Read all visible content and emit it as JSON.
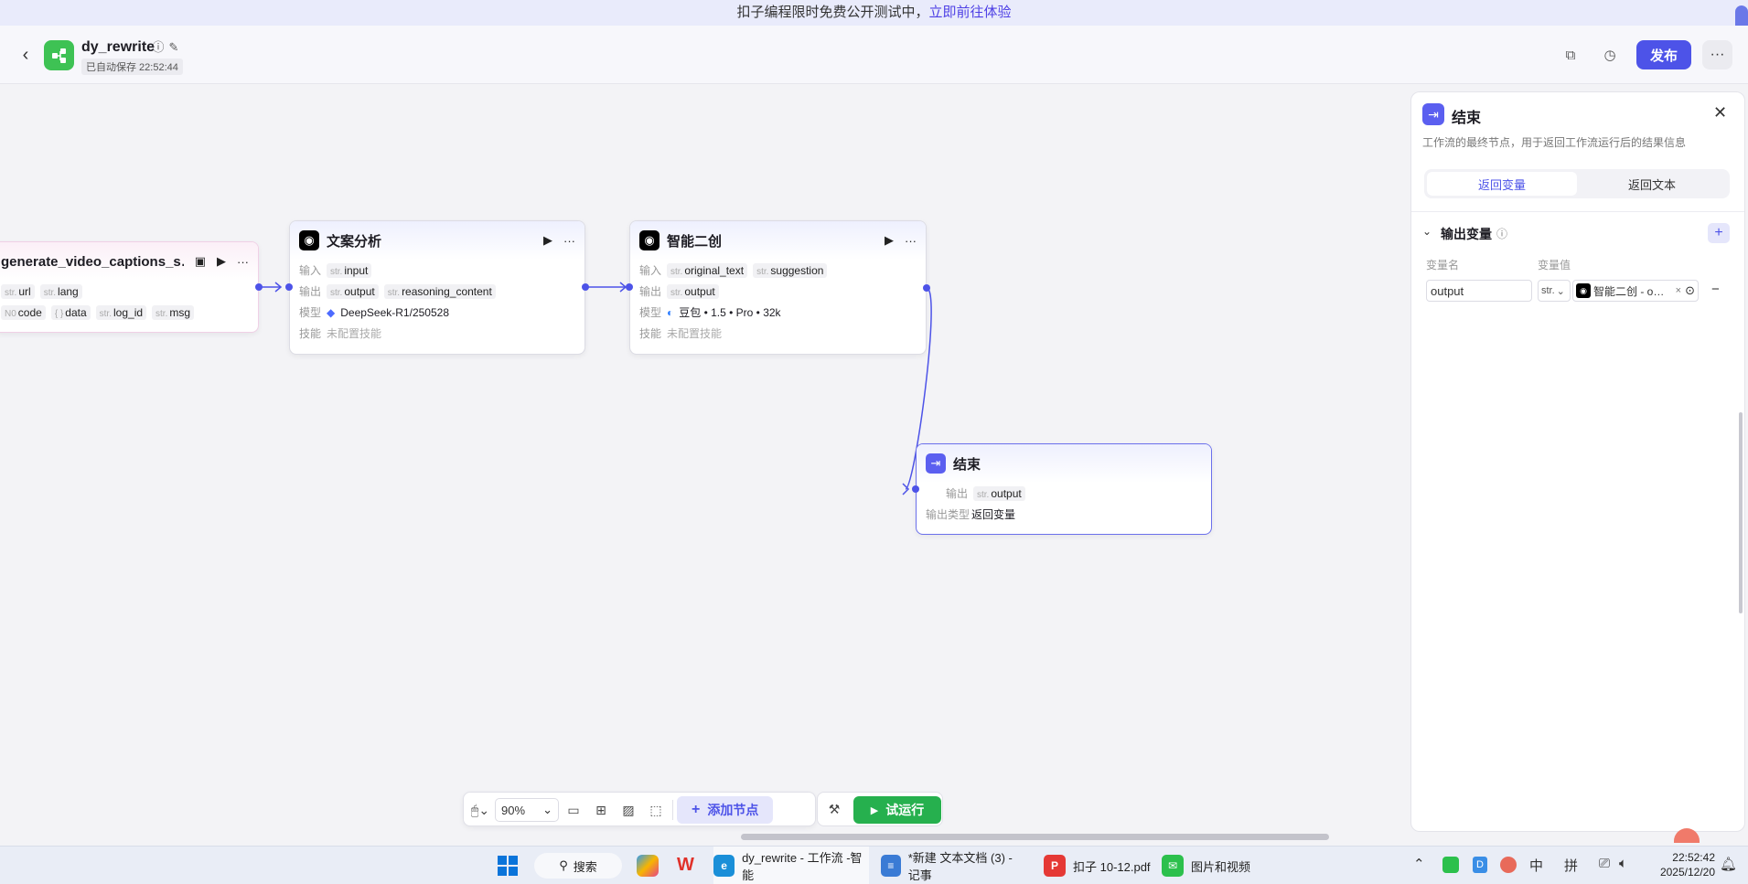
{
  "banner": {
    "text": "扣子编程限时免费公开测试中，",
    "link": "立即前往体验"
  },
  "header": {
    "app_name": "dy_rewrite",
    "autosave": "已自动保存 22:52:44",
    "publish": "发布"
  },
  "nodes": {
    "gen": {
      "title": "generate_video_captions_s…",
      "inputs": [
        {
          "type": "str.",
          "name": "url"
        },
        {
          "type": "str.",
          "name": "lang"
        }
      ],
      "outputs": [
        {
          "type": "N0",
          "name": "code"
        },
        {
          "type": "{ }",
          "name": "data"
        },
        {
          "type": "str.",
          "name": "log_id"
        },
        {
          "type": "str.",
          "name": "msg"
        }
      ]
    },
    "analysis": {
      "title": "文案分析",
      "in_label": "输入",
      "out_label": "输出",
      "model_label": "模型",
      "skill_label": "技能",
      "inputs": [
        {
          "type": "str.",
          "name": "input"
        }
      ],
      "outputs": [
        {
          "type": "str.",
          "name": "output"
        },
        {
          "type": "str.",
          "name": "reasoning_content"
        }
      ],
      "model": "DeepSeek-R1/250528",
      "skills": "未配置技能"
    },
    "rewrite": {
      "title": "智能二创",
      "in_label": "输入",
      "out_label": "输出",
      "model_label": "模型",
      "skill_label": "技能",
      "inputs": [
        {
          "type": "str.",
          "name": "original_text"
        },
        {
          "type": "str.",
          "name": "suggestion"
        }
      ],
      "outputs": [
        {
          "type": "str.",
          "name": "output"
        }
      ],
      "model": "豆包 • 1.5 • Pro • 32k",
      "skills": "未配置技能"
    },
    "end": {
      "title": "结束",
      "out_label": "输出",
      "out_type_label": "输出类型",
      "outputs": [
        {
          "type": "str.",
          "name": "output"
        }
      ],
      "out_type": "返回变量"
    }
  },
  "panel": {
    "title": "结束",
    "desc": "工作流的最终节点，用于返回工作流运行后的结果信息",
    "tabs": [
      "返回变量",
      "返回文本"
    ],
    "section": "输出变量",
    "col_name": "变量名",
    "col_value": "变量值",
    "var_name": "output",
    "var_type": "str.",
    "var_ref": "智能二创 - o…"
  },
  "toolbar": {
    "zoom": "90%",
    "add_node": "添加节点",
    "run": "试运行"
  },
  "taskbar": {
    "search": "搜索",
    "apps": [
      "dy_rewrite - 工作流 -智能",
      "*新建 文本文档 (3) - 记事",
      "扣子 10-12.pdf",
      "图片和视频"
    ],
    "ime1": "中",
    "ime2": "拼",
    "time": "22:52:42",
    "date": "2025/12/20"
  },
  "colors": {
    "accent": "#4d53e8",
    "run": "#26b04e",
    "app_logo": "#3ec254"
  }
}
